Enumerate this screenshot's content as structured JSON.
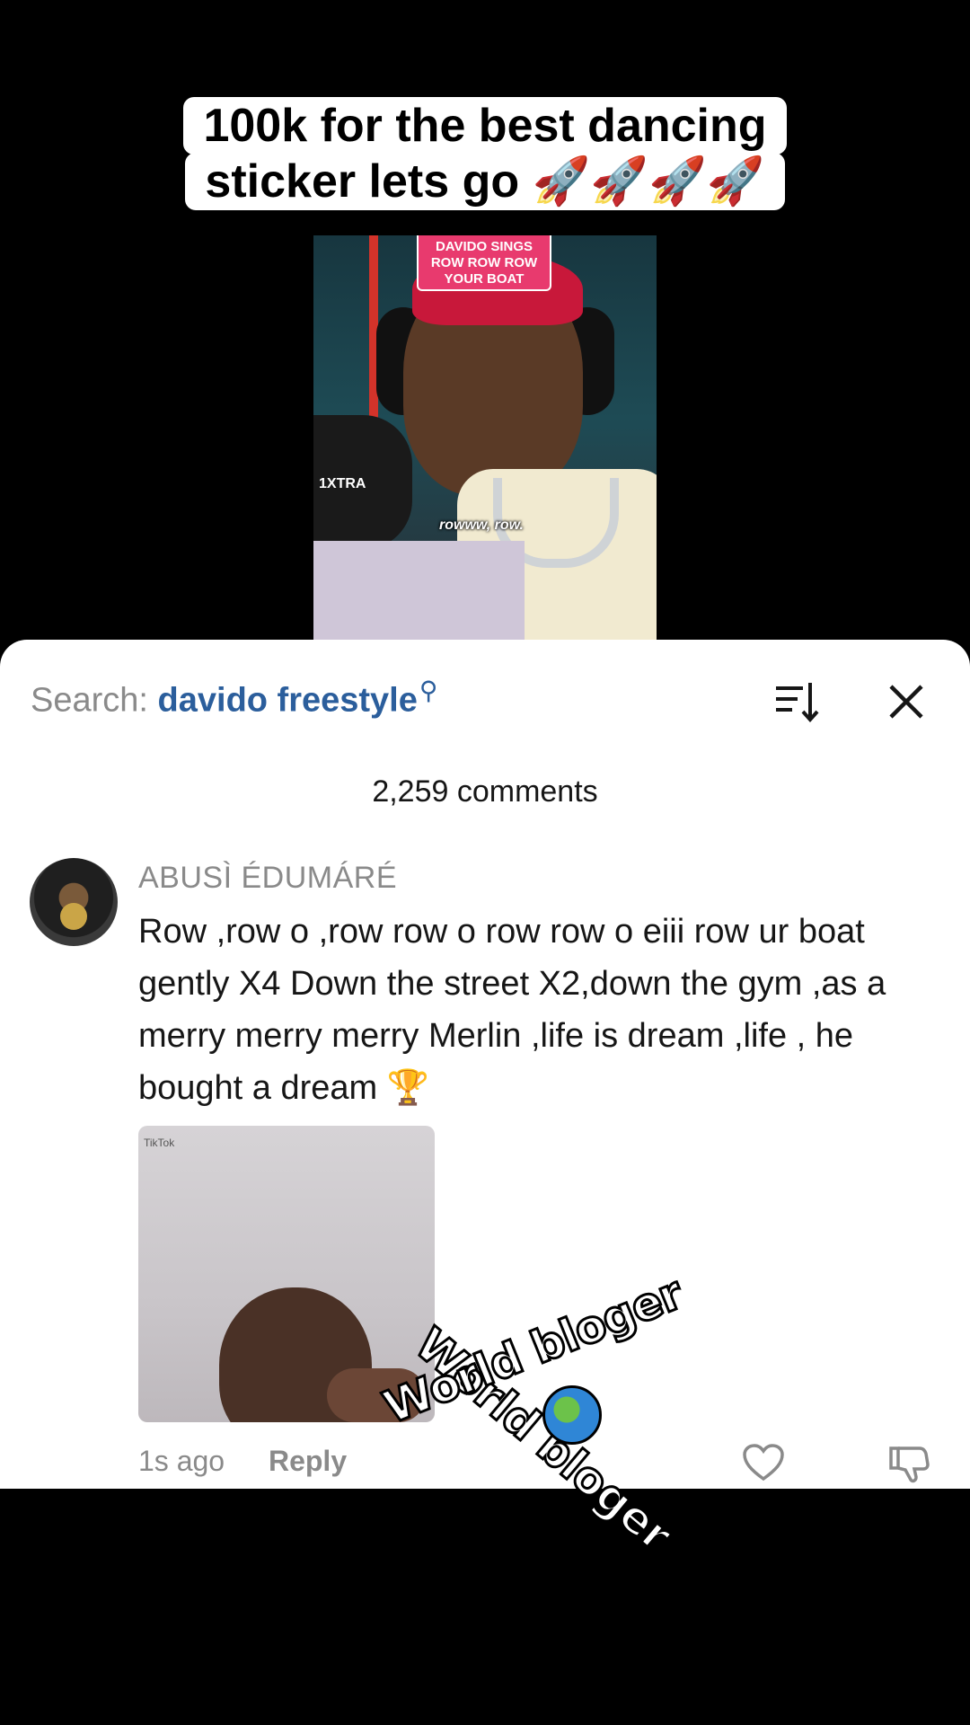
{
  "caption": {
    "line1": "100k for the best dancing",
    "line2": "sticker lets go 🚀🚀🚀🚀"
  },
  "video": {
    "tag": "DAVIDO SINGS ROW ROW ROW YOUR BOAT",
    "mic_label": "1XTRA",
    "subtitle": "rowww, row."
  },
  "search": {
    "label": "Search:",
    "query": "davido freestyle",
    "query_icon": "🔍"
  },
  "comments_count": "2,259 comments",
  "comment": {
    "username": "ABUSÌ ÉDUMÁRÉ",
    "text": "Row ,row o ,row row o row row o eiii row ur boat gently X4 Down the street X2,down the gym ,as a merry merry merry Merlin ,life is dream ,life , he bought a dream 🏆",
    "image_watermark": "TikTok",
    "time": "1s ago",
    "reply": "Reply"
  },
  "watermark": {
    "text1": "World",
    "text2": "bloger"
  }
}
